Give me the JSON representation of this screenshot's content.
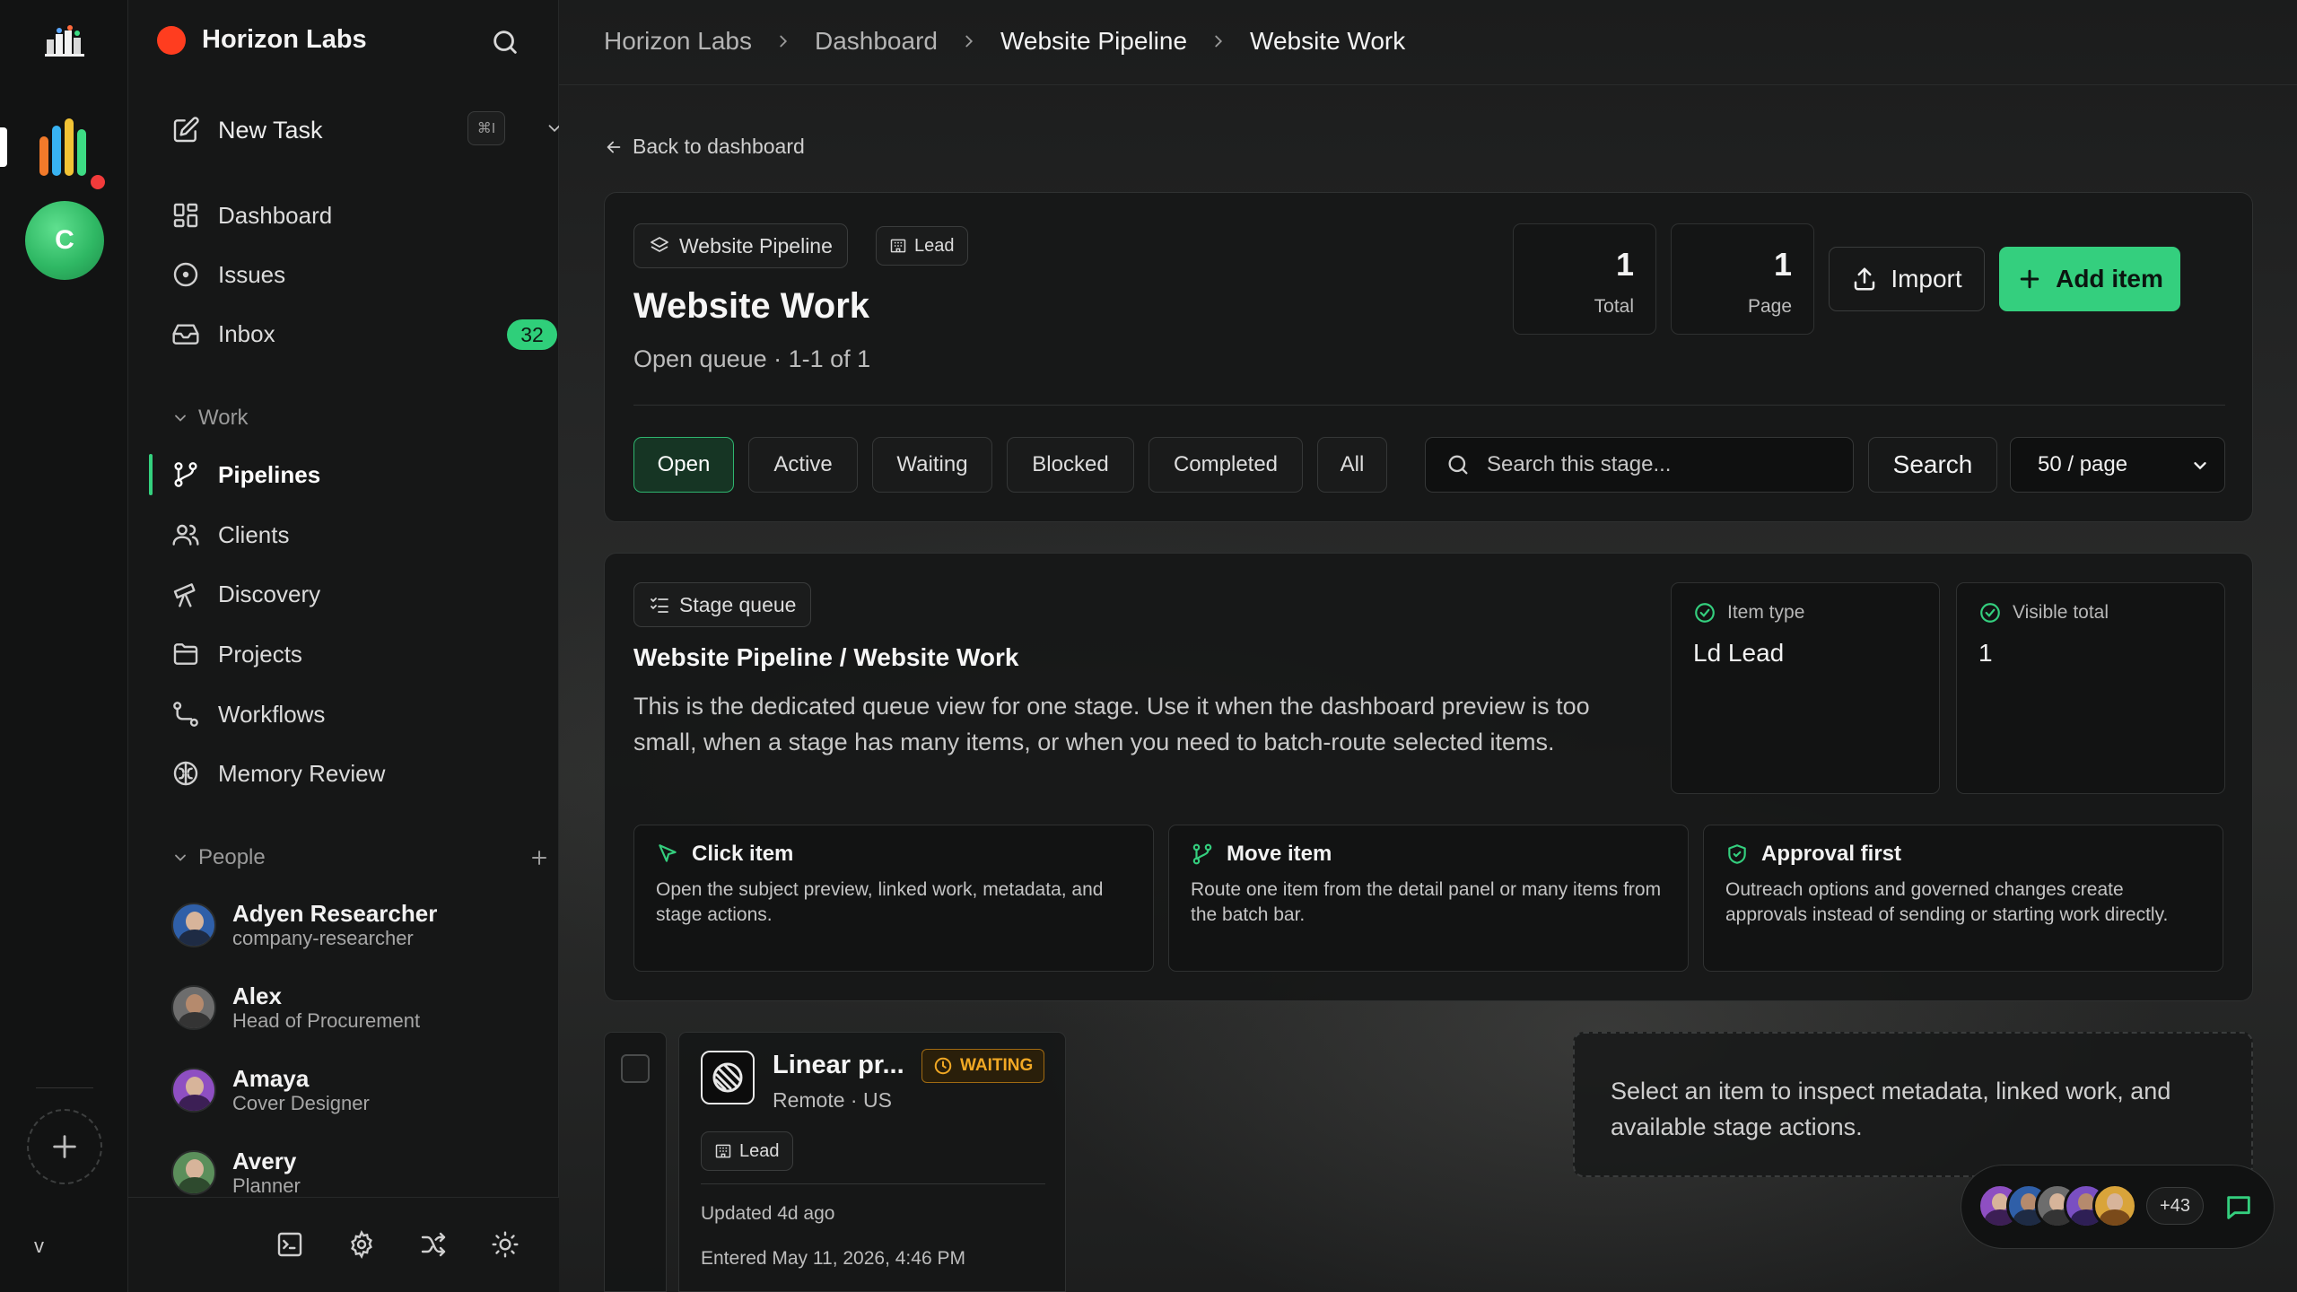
{
  "workspace": {
    "name": "Horizon Labs"
  },
  "sidebar": {
    "new_task": {
      "label": "New Task",
      "shortcut": "⌘I"
    },
    "nav": [
      {
        "label": "Dashboard",
        "icon": "dashboard-icon"
      },
      {
        "label": "Issues",
        "icon": "issues-icon"
      },
      {
        "label": "Inbox",
        "icon": "inbox-icon",
        "badge": "32"
      }
    ],
    "work_section": "Work",
    "work_items": [
      {
        "label": "Pipelines",
        "icon": "pipelines-icon",
        "active": true
      },
      {
        "label": "Clients",
        "icon": "clients-icon"
      },
      {
        "label": "Discovery",
        "icon": "telescope-icon"
      },
      {
        "label": "Projects",
        "icon": "folder-icon"
      },
      {
        "label": "Workflows",
        "icon": "workflow-icon"
      },
      {
        "label": "Memory Review",
        "icon": "brain-icon"
      }
    ],
    "people_section": "People",
    "people": [
      {
        "name": "Adyen Researcher",
        "role": "company-researcher"
      },
      {
        "name": "Alex",
        "role": "Head of Procurement"
      },
      {
        "name": "Amaya",
        "role": "Cover Designer"
      },
      {
        "name": "Avery",
        "role": "Planner"
      }
    ]
  },
  "rail": {
    "avatar_letter": "C",
    "version": "v"
  },
  "breadcrumbs": [
    "Horizon Labs",
    "Dashboard",
    "Website Pipeline",
    "Website Work"
  ],
  "back_link": "Back to dashboard",
  "header": {
    "pipeline_chip": "Website Pipeline",
    "type_chip": "Lead",
    "title": "Website Work",
    "subtitle": "Open queue · 1-1 of 1",
    "stats": [
      {
        "value": "1",
        "label": "Total"
      },
      {
        "value": "1",
        "label": "Page"
      }
    ],
    "import_label": "Import",
    "add_label": "Add item"
  },
  "filters": [
    "Open",
    "Active",
    "Waiting",
    "Blocked",
    "Completed",
    "All"
  ],
  "active_filter": "Open",
  "search": {
    "placeholder": "Search this stage...",
    "button": "Search"
  },
  "page_size": "50 / page",
  "stage": {
    "chip": "Stage queue",
    "title": "Website Pipeline / Website Work",
    "description": "This is the dedicated queue view for one stage. Use it when the dashboard preview is too small, when a stage has many items, or when you need to batch-route selected items.",
    "item_type_label": "Item type",
    "item_type_value": "Ld Lead",
    "visible_total_label": "Visible total",
    "visible_total_value": "1",
    "tips": [
      {
        "title": "Click item",
        "desc": "Open the subject preview, linked work, metadata, and stage actions."
      },
      {
        "title": "Move item",
        "desc": "Route one item from the detail panel or many items from the batch bar."
      },
      {
        "title": "Approval first",
        "desc": "Outreach options and governed changes create approvals instead of sending or starting work directly."
      }
    ]
  },
  "item": {
    "name": "Linear pr...",
    "location": "Remote · US",
    "status": "WAITING",
    "tag": "Lead",
    "updated": "Updated 4d ago",
    "entered": "Entered May 11, 2026, 4:46 PM"
  },
  "inspect_hint": "Select an item to inspect metadata, linked work, and available stage actions.",
  "presence": {
    "more": "+43"
  },
  "colors": {
    "accent": "#34cf7e",
    "warning": "#f1a824",
    "workspace_dot": "#ff3d1f"
  }
}
